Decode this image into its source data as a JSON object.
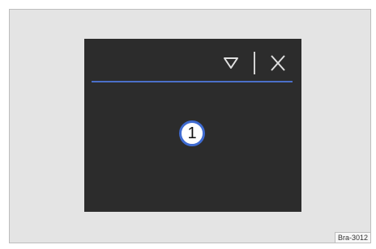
{
  "screen": {
    "icons": {
      "menu": "triangle-down-icon",
      "close": "close-icon"
    },
    "colors": {
      "screen_bg": "#2c2c2c",
      "accent_line": "#4b6fc8",
      "callout_border": "#3f6bd1"
    }
  },
  "callout": {
    "number": "1"
  },
  "figure": {
    "reference": "Bra-3012"
  }
}
